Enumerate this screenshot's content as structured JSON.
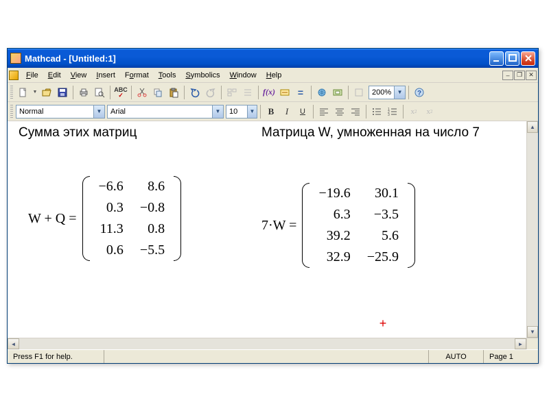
{
  "window": {
    "title": "Mathcad - [Untitled:1]"
  },
  "menu": {
    "file": "File",
    "edit": "Edit",
    "view": "View",
    "insert": "Insert",
    "format": "Format",
    "tools": "Tools",
    "symbolics": "Symbolics",
    "window": "Window",
    "help": "Help"
  },
  "toolbar": {
    "zoom": "200%"
  },
  "format_bar": {
    "style": "Normal",
    "font": "Arial",
    "size": "10",
    "bold": "B",
    "italic": "I",
    "underline": "U"
  },
  "doc": {
    "heading_left": "Сумма этих матриц",
    "heading_right": "Матрица W, умноженная на число 7",
    "lhs_left": "W + Q =",
    "lhs_right": "7·W =",
    "matrix_left": [
      [
        "−6.6",
        "8.6"
      ],
      [
        "0.3",
        "−0.8"
      ],
      [
        "11.3",
        "0.8"
      ],
      [
        "0.6",
        "−5.5"
      ]
    ],
    "matrix_right": [
      [
        "−19.6",
        "30.1"
      ],
      [
        "6.3",
        "−3.5"
      ],
      [
        "39.2",
        "5.6"
      ],
      [
        "32.9",
        "−25.9"
      ]
    ]
  },
  "status": {
    "help": "Press F1 for help.",
    "auto": "AUTO",
    "page": "Page 1"
  },
  "chart_data": [
    {
      "type": "table",
      "title": "W + Q",
      "values": [
        [
          -6.6,
          8.6
        ],
        [
          0.3,
          -0.8
        ],
        [
          11.3,
          0.8
        ],
        [
          0.6,
          -5.5
        ]
      ]
    },
    {
      "type": "table",
      "title": "7·W",
      "values": [
        [
          -19.6,
          30.1
        ],
        [
          6.3,
          -3.5
        ],
        [
          39.2,
          5.6
        ],
        [
          32.9,
          -25.9
        ]
      ]
    }
  ]
}
